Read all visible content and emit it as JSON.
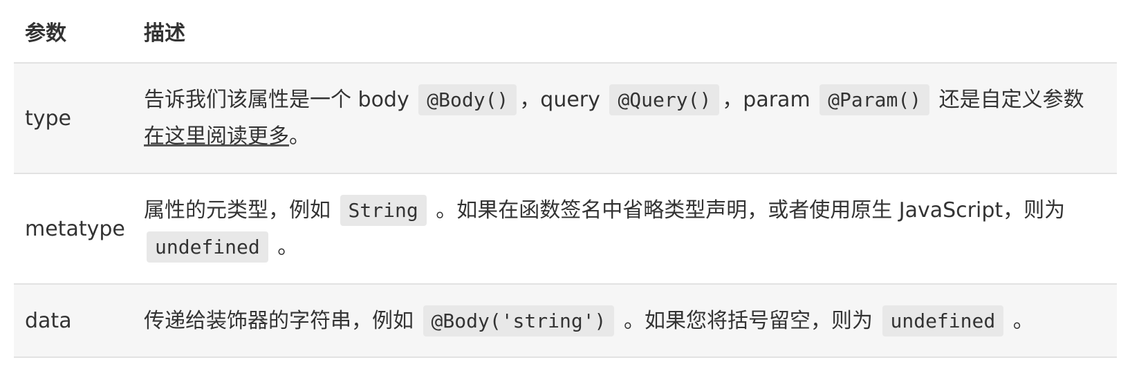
{
  "table": {
    "headers": [
      "参数",
      "描述"
    ],
    "rows": [
      {
        "param": "type",
        "desc": {
          "t1": "告诉我们该属性是一个 body ",
          "c1": "@Body()",
          "t2": "，query ",
          "c2": "@Query()",
          "t3": "，param ",
          "c3": "@Param()",
          "t4": " 还是自定义参数 ",
          "link": "在这里阅读更多",
          "t5": "。"
        }
      },
      {
        "param": "metatype",
        "desc": {
          "t1": "属性的元类型，例如 ",
          "c1": "String",
          "t2": " 。如果在函数签名中省略类型声明，或者使用原生 JavaScript，则为 ",
          "c2": "undefined",
          "t3": " 。"
        }
      },
      {
        "param": "data",
        "desc": {
          "t1": "传递给装饰器的字符串，例如 ",
          "c1": "@Body('string')",
          "t2": " 。如果您将括号留空，则为 ",
          "c2": "undefined",
          "t3": " 。"
        }
      }
    ]
  }
}
